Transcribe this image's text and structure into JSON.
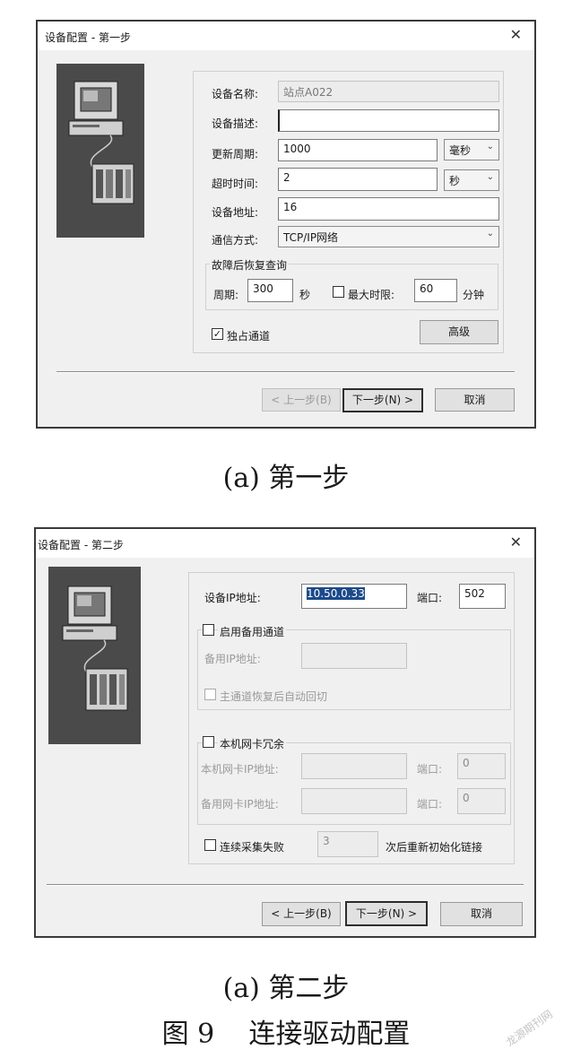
{
  "step1": {
    "title": "设备配置 - 第一步",
    "close": "✕",
    "name_label": "设备名称:",
    "name_value": "站点A022",
    "desc_label": "设备描述:",
    "desc_value": "",
    "period_label": "更新周期:",
    "period_value": "1000",
    "period_unit": "毫秒",
    "timeout_label": "超时时间:",
    "timeout_value": "2",
    "timeout_unit": "秒",
    "addr_label": "设备地址:",
    "addr_value": "16",
    "comm_label": "通信方式:",
    "comm_value": "TCP/IP网络",
    "recovery_group": "故障后恢复查询",
    "cycle_label": "周期:",
    "cycle_value": "300",
    "cycle_unit": "秒",
    "maxlimit_label": "最大时限:",
    "maxlimit_value": "60",
    "maxlimit_unit": "分钟",
    "exclusive_label": "独占通道",
    "exclusive_check": "✓",
    "advanced_btn": "高级",
    "prev_btn": "< 上一步(B)",
    "next_btn": "下一步(N) >",
    "cancel_btn": "取消"
  },
  "caption1": "(a) 第一步",
  "step2": {
    "title": "设备配置 - 第二步",
    "close": "✕",
    "ip_label": "设备IP地址:",
    "ip_value": "10.50.0.33",
    "port_label": "端口:",
    "port_value": "502",
    "backup_channel_label": "启用备用通道",
    "backup_ip_label": "备用IP地址:",
    "backup_ip_value": "",
    "auto_switch_label": "主通道恢复后自动回切",
    "nic_redundancy_label": "本机网卡冗余",
    "local_nic_label": "本机网卡IP地址:",
    "local_nic_value": "",
    "local_port_label": "端口:",
    "local_port_value": "0",
    "backup_nic_label": "备用网卡IP地址:",
    "backup_nic_value": "",
    "backup_port_label": "端口:",
    "backup_port_value": "0",
    "fail_label": "连续采集失败",
    "fail_value": "3",
    "fail_suffix": "次后重新初始化链接",
    "prev_btn": "< 上一步(B)",
    "next_btn": "下一步(N) >",
    "cancel_btn": "取消"
  },
  "caption2": "(a) 第二步",
  "figure_caption": "图 9    连接驱动配置",
  "watermark": "龙源期刊网"
}
